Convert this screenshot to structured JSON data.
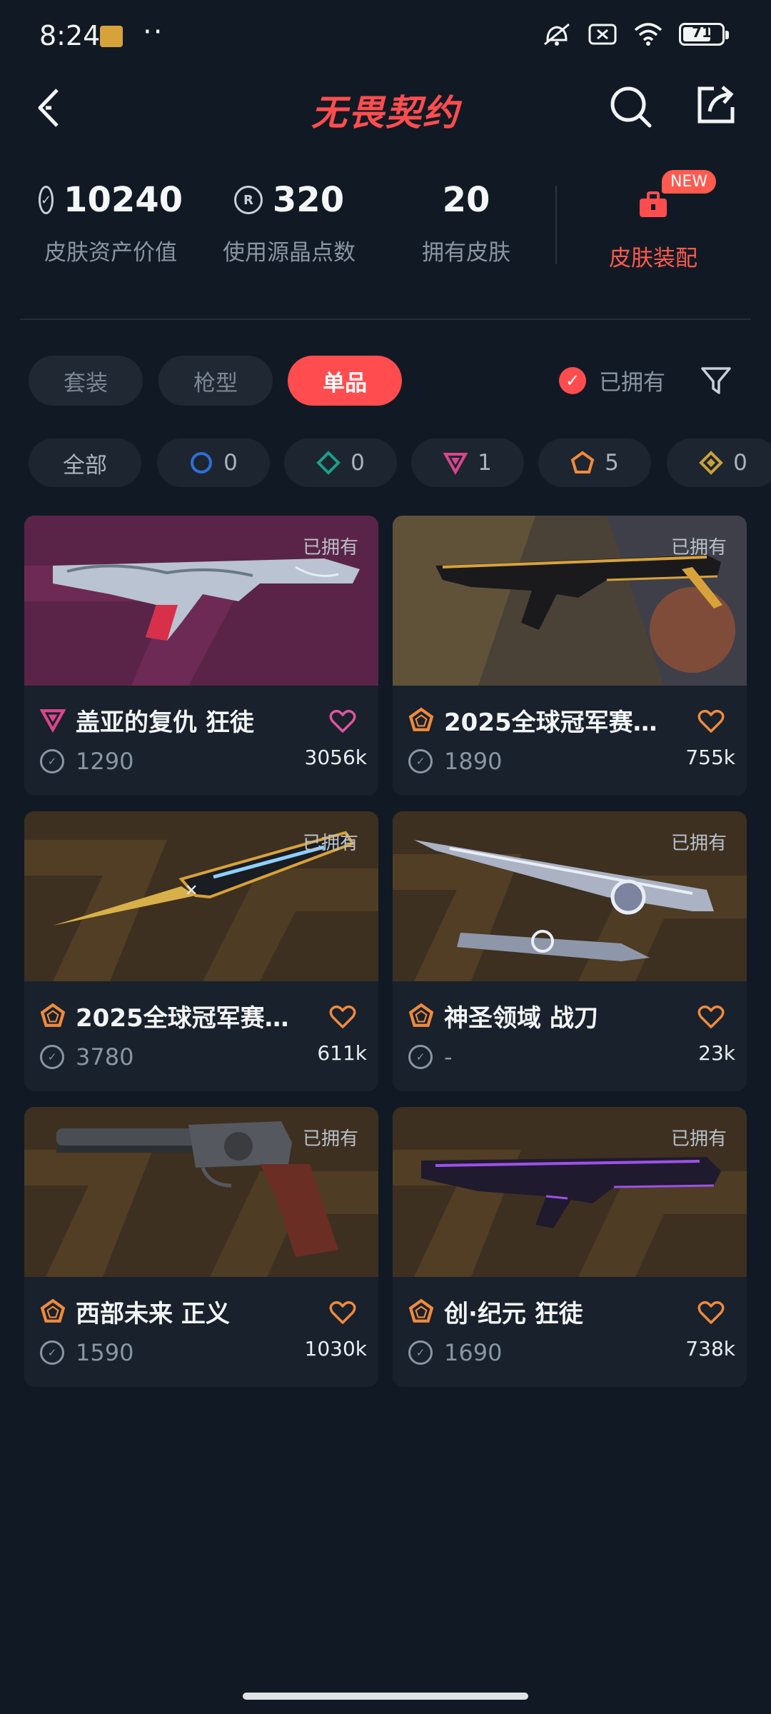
{
  "status": {
    "time": "8:24",
    "dots": "··",
    "battery": "71"
  },
  "header": {
    "logo": "无畏契约"
  },
  "stats": [
    {
      "value": "10240",
      "label": "皮肤资产价值",
      "icon": "vp-icon"
    },
    {
      "value": "320",
      "label": "使用源晶点数",
      "icon": "radianite-icon"
    },
    {
      "value": "20",
      "label": "拥有皮肤",
      "icon": ""
    }
  ],
  "equip": {
    "badge": "NEW",
    "label": "皮肤装配"
  },
  "tabs": [
    {
      "label": "套装",
      "active": false
    },
    {
      "label": "枪型",
      "active": false
    },
    {
      "label": "单品",
      "active": true
    }
  ],
  "owned_filter": {
    "label": "已拥有",
    "checked": true
  },
  "rarity_filters": [
    {
      "label": "全部",
      "icon": "",
      "count": ""
    },
    {
      "label": "",
      "icon": "select-tier-icon",
      "count": "0",
      "color": "#2f6fd6"
    },
    {
      "label": "",
      "icon": "deluxe-tier-icon",
      "count": "0",
      "color": "#1aa088"
    },
    {
      "label": "",
      "icon": "premium-tier-icon",
      "count": "1",
      "color": "#d9468c"
    },
    {
      "label": "",
      "icon": "exclusive-tier-icon",
      "count": "5",
      "color": "#f08a3c"
    },
    {
      "label": "",
      "icon": "ultra-tier-icon",
      "count": "0",
      "color": "#c9a13b"
    }
  ],
  "cards": [
    {
      "title": "盖亚的复仇 狂徒",
      "price": "1290",
      "likes": "3056k",
      "owned": "已拥有",
      "tier": "premium",
      "weapon": "rifle-thorn"
    },
    {
      "title": "2025全球冠军赛…",
      "price": "1890",
      "likes": "755k",
      "owned": "已拥有",
      "tier": "exclusive",
      "weapon": "rifle-gold"
    },
    {
      "title": "2025全球冠军赛…",
      "price": "3780",
      "likes": "611k",
      "owned": "已拥有",
      "tier": "exclusive",
      "weapon": "knife-gold"
    },
    {
      "title": "神圣领域 战刀",
      "price": "-",
      "likes": "23k",
      "owned": "已拥有",
      "tier": "exclusive",
      "weapon": "blade-silver"
    },
    {
      "title": "西部未来 正义",
      "price": "1590",
      "likes": "1030k",
      "owned": "已拥有",
      "tier": "exclusive",
      "weapon": "revolver"
    },
    {
      "title": "创·纪元 狂徒",
      "price": "1690",
      "likes": "738k",
      "owned": "已拥有",
      "tier": "exclusive",
      "weapon": "rifle-purple"
    }
  ],
  "colors": {
    "accent": "#ff4d4f",
    "background": "#111a24",
    "card": "#18212c",
    "heart": "#f08a3c",
    "heart_premium": "#e0559c"
  }
}
